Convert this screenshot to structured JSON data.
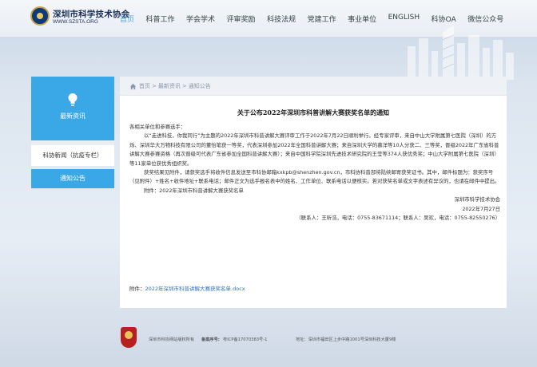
{
  "header": {
    "org_name": "深圳市科学技术协会",
    "org_url": "WWW.SZSTA.ORG",
    "nav": [
      "首页",
      "科普工作",
      "学会学术",
      "评审奖励",
      "科技法规",
      "党建工作",
      "事业单位",
      "ENGLISH",
      "科协OA",
      "微信公众号"
    ]
  },
  "sidebar": {
    "top_label": "最新资讯",
    "items": [
      {
        "label": "科协新闻（抗疫专栏）"
      },
      {
        "label": "通知公告"
      }
    ]
  },
  "breadcrumb": {
    "home": "首页",
    "sep": ">",
    "level1": "最新资讯",
    "level2": "通知公告"
  },
  "article": {
    "title": "关于公布2022年深圳市科普讲解大赛获奖名单的通知",
    "salutation": "各相关单位和参赛选手：",
    "para1": "以“走进科技，你我同行”为主题的2022年深圳市科普讲解大赛评审工作于2022年7月22日顺利举行。经专家评审，来自中山大学附属第七医院（深圳）的方烁、深圳华大万物科技有限公司的董怡笔获一等奖，代表深圳参加2022年全国科普讲解大赛；来自深圳大学的慕洋等10人分获二、三等奖，晋级2022年广东省科普讲解大赛参赛资格（再次晋级可代表广东省参加全国科普讲解大赛）；来自中国科学院深圳先进技术研究院的王莹等374人获优秀奖；中山大学附属第七医院（深圳）等11家单位获优秀组织奖。",
    "para2": "获奖结果见附件，请获奖选手将收件信息发送至市科协邮箱kxkpb@shenzhen.gov.cn，市科协科普部将陆续邮寄获奖证书。其中，邮件标题为：获奖序号（见附件）+姓名+收件地址+联系电话；邮件正文为选手报名表中的姓名、工作单位、联系电话以便核实。若对获奖名单或文字表述有异议的，也请在邮件中提出。",
    "para3": "附件：2022年深圳市科普讲解大赛获奖名单",
    "signature": "深圳市科学技术协会",
    "date": "2022年7月27日",
    "contact": "（联系人：王昕浩，电话：0755-83671114；联系人：吴欢，电话：0755-82550276）",
    "attach_prefix": "附件：",
    "attach_link": "2022年深圳市科普讲解大赛获奖名单.docx"
  },
  "footer": {
    "copyright": "深圳市科协网站版权所有",
    "icp_label": "备案序号:",
    "icp": "粤ICP备17070383号-1",
    "address": "地址：深圳市福田区上步中路1001号深圳科技大厦9楼"
  },
  "colors": {
    "accent": "#3aa7e6",
    "link": "#2a6fc0",
    "nav_active": "#4aa3dc"
  }
}
